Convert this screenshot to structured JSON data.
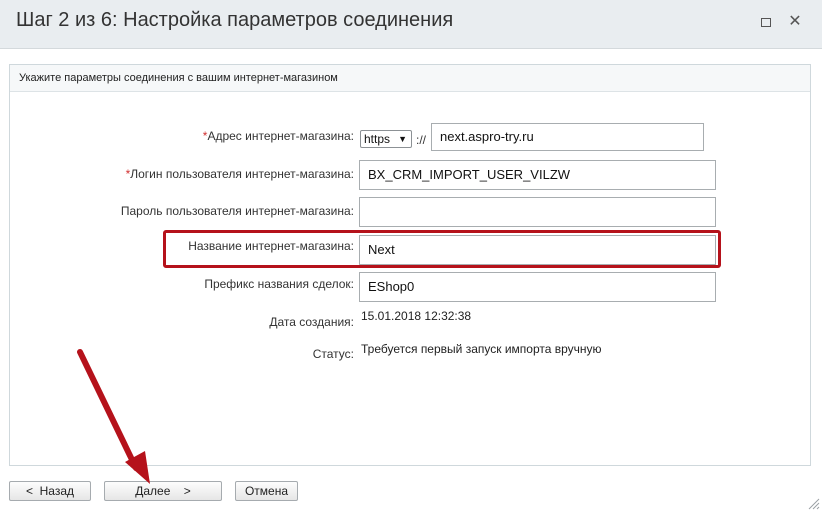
{
  "window": {
    "title": "Шаг 2 из 6: Настройка параметров соединения",
    "maximize_icon": "maximize-icon",
    "close_icon": "close-icon",
    "close_glyph": "✕"
  },
  "panel": {
    "header": "Укажите параметры соединения с вашим интернет-магазином"
  },
  "form": {
    "required_mark": "*",
    "shop_address_label": "Адрес интернет-магазина:",
    "protocol_value": "https",
    "protocol_separator": "://",
    "shop_address_value": "next.aspro-try.ru",
    "login_label": "Логин пользователя интернет-магазина:",
    "login_value": "BX_CRM_IMPORT_USER_VILZW",
    "password_label": "Пароль пользователя интернет-магазина:",
    "password_value": "",
    "shop_name_label": "Название интернет-магазина:",
    "shop_name_value": "Next",
    "deal_prefix_label": "Префикс названия сделок:",
    "deal_prefix_value": "EShop0",
    "created_label": "Дата создания:",
    "created_value": "15.01.2018 12:32:38",
    "status_label": "Статус:",
    "status_value": "Требуется первый запуск импорта вручную"
  },
  "footer": {
    "back_label": "<  Назад",
    "next_label": "Далее    >",
    "cancel_label": "Отмена"
  },
  "colors": {
    "annotation_red": "#b5121b",
    "required_red": "#d13030"
  }
}
